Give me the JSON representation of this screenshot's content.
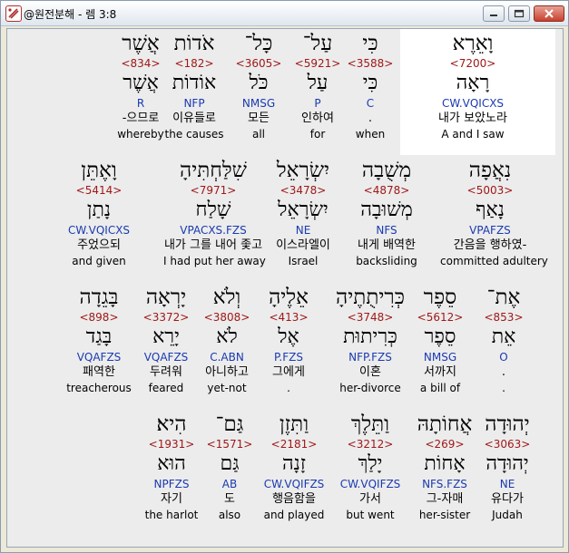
{
  "window": {
    "title": "@원전분해 - 렘 3:8",
    "controls": [
      "minimize",
      "maximize",
      "close"
    ]
  },
  "rows": [
    [
      {
        "heb": "אֲשֶׁר",
        "num": "<834>",
        "lemma": "אֲשֶׁר",
        "code": "R",
        "kor": "-으므로",
        "eng": "whereby"
      },
      {
        "heb": "אֹדוֹת",
        "num": "<182>",
        "lemma": "אוֹדוֹת",
        "code": "NFP",
        "kor": "이유들로",
        "eng": "the causes"
      },
      {
        "heb": "כָּל־",
        "num": "<3605>",
        "lemma": "כֹּל",
        "code": "NMSG",
        "kor": "모든",
        "eng": "all"
      },
      {
        "heb": "עַל־",
        "num": "<5921>",
        "lemma": "עַל",
        "code": "P",
        "kor": "인하여",
        "eng": "for"
      },
      {
        "heb": "כִּי",
        "num": "<3588>",
        "lemma": "כִּי",
        "code": "C",
        "kor": ".",
        "eng": "when"
      },
      {
        "heb": "וָאֵרֶא",
        "num": "<7200>",
        "lemma": "רָאָה",
        "code": "CW.VQICXS",
        "kor": "내가 보았노라",
        "eng": "A and I saw"
      }
    ],
    [
      {
        "heb": "וָאֶתֵּן",
        "num": "<5414>",
        "lemma": "נָתַן",
        "code": "CW.VQICXS",
        "kor": "주었으되",
        "eng": "and given"
      },
      {
        "heb": "שִׁלַּחְתִּיהָ",
        "num": "<7971>",
        "lemma": "שָׁלַח",
        "code": "VPACXS.FZS",
        "kor": "내가 그를 내어 좇고",
        "eng": "I had put her away"
      },
      {
        "heb": "יִשְׂרָאֵל",
        "num": "<3478>",
        "lemma": "יִשְׂרָאֵל",
        "code": "NE",
        "kor": "이스라엘이",
        "eng": "Israel"
      },
      {
        "heb": "מְשֻׁבָה",
        "num": "<4878>",
        "lemma": "מְשׁוּבָה",
        "code": "NFS",
        "kor": "내게 배역한",
        "eng": "backsliding"
      },
      {
        "heb": "נִאֲפָה",
        "num": "<5003>",
        "lemma": "נָאַף",
        "code": "VPAFZS",
        "kor": "간음을 행하였-",
        "eng": "committed adultery"
      }
    ],
    [
      {
        "heb": "בָּגֵדָה",
        "num": "<898>",
        "lemma": "בָּגַד",
        "code": "VQAFZS",
        "kor": "패역한",
        "eng": "treacherous"
      },
      {
        "heb": "יָרְאָה",
        "num": "<3372>",
        "lemma": "יָרֵא",
        "code": "VQAFZS",
        "kor": "두려워",
        "eng": "feared"
      },
      {
        "heb": "וְלֹא",
        "num": "<3808>",
        "lemma": "לֹא",
        "code": "C.ABN",
        "kor": "아니하고",
        "eng": "yet-not"
      },
      {
        "heb": "אֵלֶיהָ",
        "num": "<413>",
        "lemma": "אֶל",
        "code": "P.FZS",
        "kor": "그에게",
        "eng": "."
      },
      {
        "heb": "כְּרִיתֻתֶיהָ",
        "num": "<3748>",
        "lemma": "כְּרִיתוּת",
        "code": "NFP.FZS",
        "kor": "이혼",
        "eng": "her-divorce"
      },
      {
        "heb": "סֵפֶר",
        "num": "<5612>",
        "lemma": "סֵפֶר",
        "code": "NMSG",
        "kor": "서까지",
        "eng": "a bill of"
      },
      {
        "heb": "אֶת־",
        "num": "<853>",
        "lemma": "אֵת",
        "code": "O",
        "kor": ".",
        "eng": "."
      }
    ],
    [
      {
        "heb": "הִיא׃",
        "num": "<1931>",
        "lemma": "הוּא",
        "code": "NPFZS",
        "kor": "자기",
        "eng": "the harlot"
      },
      {
        "heb": "גַּם־",
        "num": "<1571>",
        "lemma": "גַּם",
        "code": "AB",
        "kor": "도",
        "eng": "also"
      },
      {
        "heb": "וַתִּזֶן",
        "num": "<2181>",
        "lemma": "זָנָה",
        "code": "CW.VQIFZS",
        "kor": "행음함을",
        "eng": "and played"
      },
      {
        "heb": "וַתֵּלֶךְ",
        "num": "<3212>",
        "lemma": "יָלַךְ",
        "code": "CW.VQIFZS",
        "kor": "가서",
        "eng": "but went"
      },
      {
        "heb": "אֲחוֹתָהּ",
        "num": "<269>",
        "lemma": "אָחוֹת",
        "code": "NFS.FZS",
        "kor": "그-자매",
        "eng": "her-sister"
      },
      {
        "heb": "יְהוּדָה",
        "num": "<3063>",
        "lemma": "יְהוּדָה",
        "code": "NE",
        "kor": "유다가",
        "eng": "Judah"
      }
    ]
  ]
}
